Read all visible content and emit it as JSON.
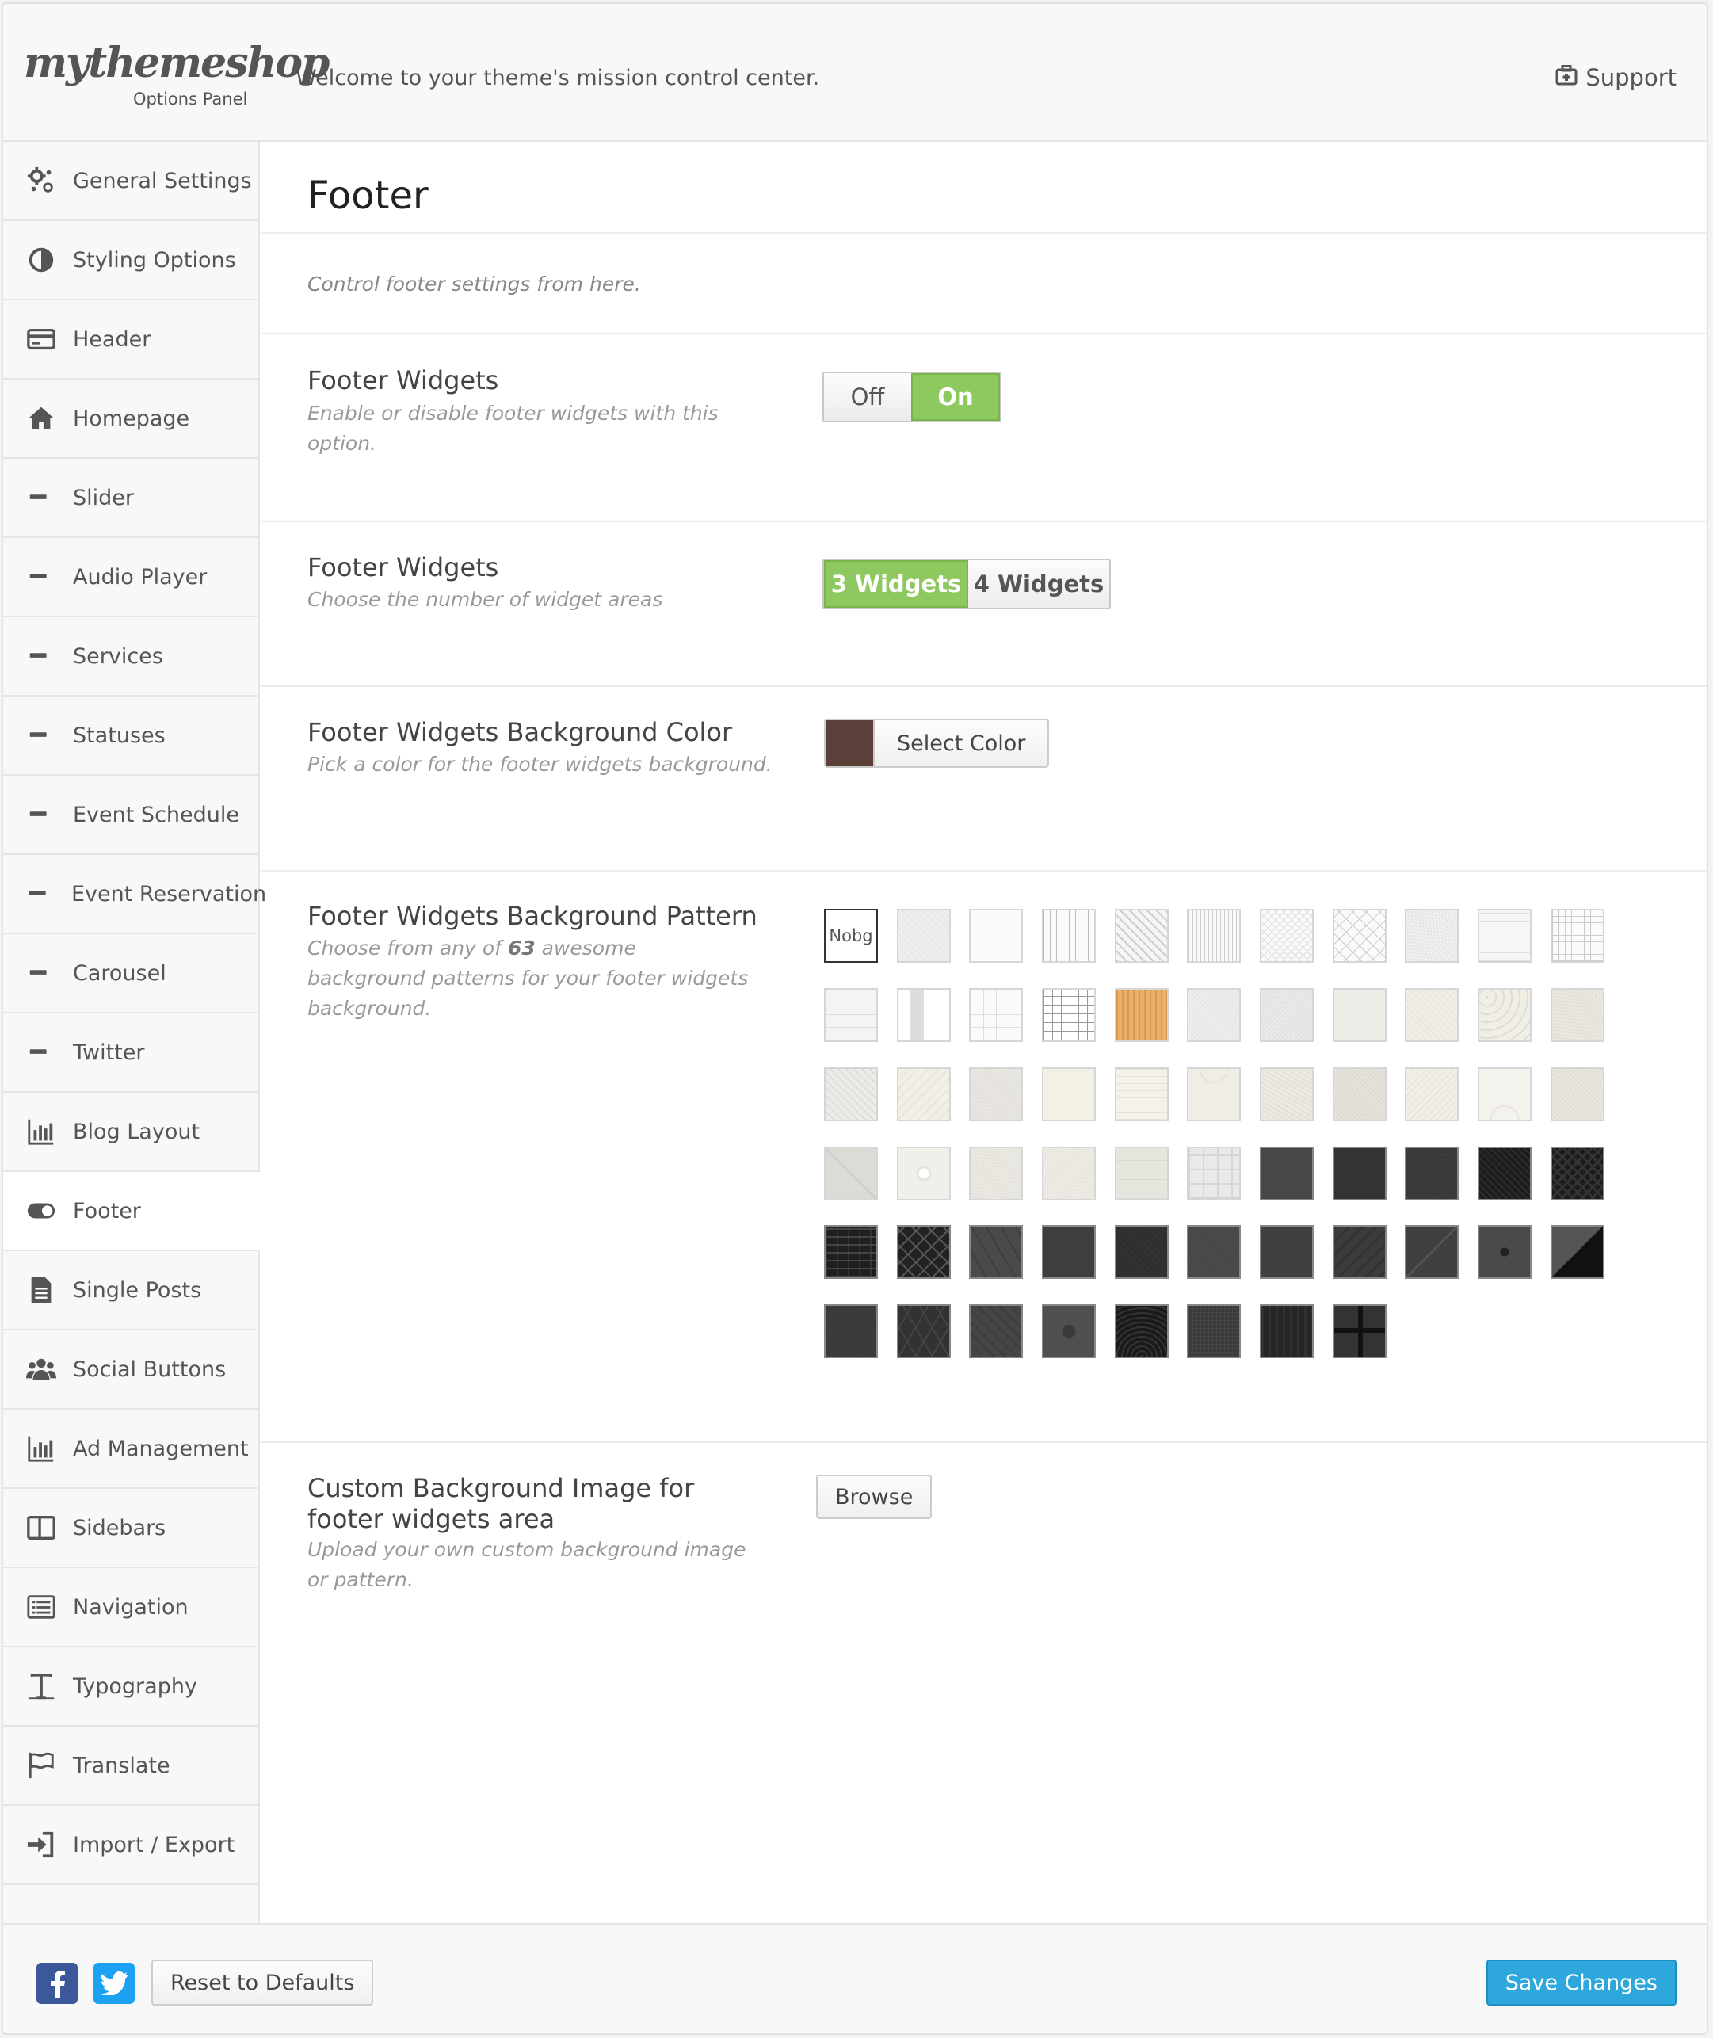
{
  "header": {
    "logo_text": "mythemeshop",
    "logo_subtitle": "Options Panel",
    "welcome": "Welcome to your theme's mission control center.",
    "support_label": "Support",
    "support_icon": "support-icon"
  },
  "sidebar": {
    "items": [
      {
        "label": "General Settings",
        "icon": "gears-icon"
      },
      {
        "label": "Styling Options",
        "icon": "contrast-icon"
      },
      {
        "label": "Header",
        "icon": "credit-card-icon"
      },
      {
        "label": "Homepage",
        "icon": "home-icon"
      },
      {
        "label": "Slider",
        "icon": "minus-icon"
      },
      {
        "label": "Audio Player",
        "icon": "minus-icon"
      },
      {
        "label": "Services",
        "icon": "minus-icon"
      },
      {
        "label": "Statuses",
        "icon": "minus-icon"
      },
      {
        "label": "Event Schedule",
        "icon": "minus-icon"
      },
      {
        "label": "Event Reservation",
        "icon": "minus-icon"
      },
      {
        "label": "Carousel",
        "icon": "minus-icon"
      },
      {
        "label": "Twitter",
        "icon": "minus-icon"
      },
      {
        "label": "Blog Layout",
        "icon": "bar-chart-icon"
      },
      {
        "label": "Footer",
        "icon": "toggle-icon",
        "active": true
      },
      {
        "label": "Single Posts",
        "icon": "document-icon"
      },
      {
        "label": "Social Buttons",
        "icon": "users-icon"
      },
      {
        "label": "Ad Management",
        "icon": "bar-chart-icon"
      },
      {
        "label": "Sidebars",
        "icon": "columns-icon"
      },
      {
        "label": "Navigation",
        "icon": "list-icon"
      },
      {
        "label": "Typography",
        "icon": "text-icon"
      },
      {
        "label": "Translate",
        "icon": "flag-icon"
      },
      {
        "label": "Import / Export",
        "icon": "sign-in-icon"
      }
    ]
  },
  "main": {
    "title": "Footer",
    "description": "Control footer settings from here.",
    "footer_widgets_toggle": {
      "title": "Footer Widgets",
      "description": "Enable or disable footer widgets with this option.",
      "off_label": "Off",
      "on_label": "On",
      "value": "On"
    },
    "footer_widgets_count": {
      "title": "Footer Widgets",
      "description": "Choose the number of widget areas",
      "option_3": "3 Widgets",
      "option_4": "4 Widgets",
      "value": "3 Widgets"
    },
    "bg_color": {
      "title": "Footer Widgets Background Color",
      "description": "Pick a color for the footer widgets background.",
      "button_label": "Select Color",
      "value": "#5b4039"
    },
    "bg_pattern": {
      "title": "Footer Widgets Background Pattern",
      "desc_before": "Choose from any of ",
      "desc_count": "63",
      "desc_after": " awesome background patterns for your footer widgets background.",
      "nobg_line1": "No",
      "nobg_line2": "bg",
      "selected": "nobg"
    },
    "custom_bg": {
      "title": "Custom Background Image for footer widgets area",
      "description": "Upload your own custom background image or pattern.",
      "button_label": "Browse"
    }
  },
  "footer": {
    "facebook_icon": "facebook-icon",
    "twitter_icon": "twitter-icon",
    "reset_label": "Reset to Defaults",
    "save_label": "Save Changes"
  },
  "colors": {
    "accent_green": "#8ec95f",
    "save_blue": "#2ea7dc",
    "facebook": "#3b5998",
    "twitter": "#1da1f2"
  }
}
